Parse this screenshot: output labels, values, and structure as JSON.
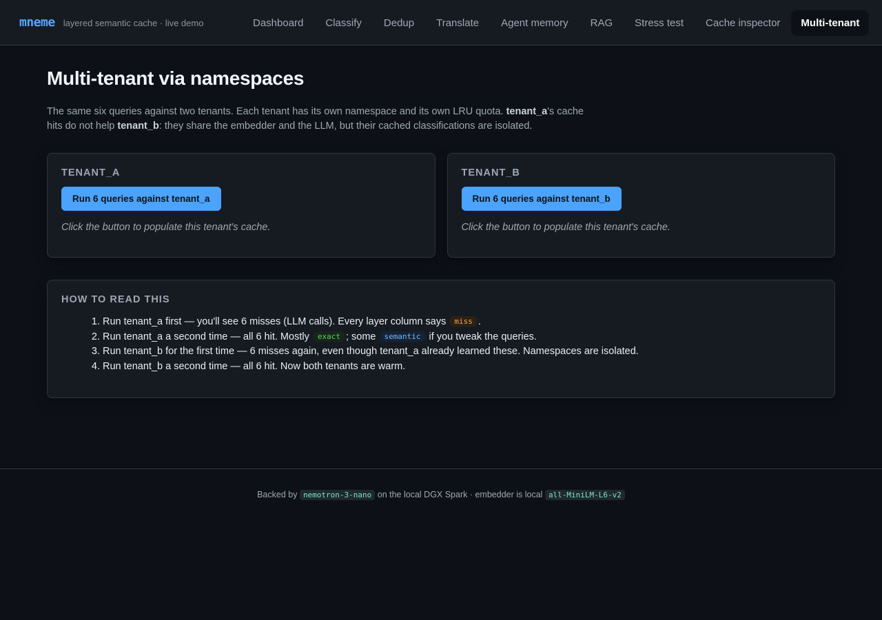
{
  "brand": {
    "name": "mneme",
    "tagline": "layered semantic cache · live demo"
  },
  "nav": {
    "items": [
      {
        "label": "Dashboard"
      },
      {
        "label": "Classify"
      },
      {
        "label": "Dedup"
      },
      {
        "label": "Translate"
      },
      {
        "label": "Agent memory"
      },
      {
        "label": "RAG"
      },
      {
        "label": "Stress test"
      },
      {
        "label": "Cache inspector"
      },
      {
        "label": "Multi-tenant"
      }
    ],
    "active": "Multi-tenant"
  },
  "page": {
    "title": "Multi-tenant via namespaces",
    "intro": {
      "part1": "The same six queries against two tenants. Each tenant has its own namespace and its own LRU quota. ",
      "bold1": "tenant_a",
      "part2": "'s cache hits do not help ",
      "bold2": "tenant_b",
      "part3": ": they share the embedder and the LLM, but their cached classifications are isolated."
    }
  },
  "tenants": [
    {
      "heading": "TENANT_A",
      "button_label": "Run 6 queries against tenant_a",
      "hint": "Click the button to populate this tenant's cache."
    },
    {
      "heading": "TENANT_B",
      "button_label": "Run 6 queries against tenant_b",
      "hint": "Click the button to populate this tenant's cache."
    }
  ],
  "howto": {
    "heading": "HOW TO READ THIS",
    "steps": [
      {
        "before": "Run tenant_a first — you'll see 6 misses (LLM calls). Every layer column says ",
        "pill": "miss",
        "after": "."
      },
      {
        "before": "Run tenant_a a second time — all 6 hit. Mostly ",
        "pill": "exact",
        "middle": "; some ",
        "pill2": "semantic",
        "after": " if you tweak the queries."
      },
      {
        "text": "Run tenant_b for the first time — 6 misses again, even though tenant_a already learned these. Namespaces are isolated."
      },
      {
        "text": "Run tenant_b a second time — all 6 hit. Now both tenants are warm."
      }
    ]
  },
  "footer": {
    "prefix": "Backed by ",
    "model": "nemotron-3-nano",
    "middle": " on the local DGX Spark · embedder is local ",
    "embedder": "all-MiniLM-L6-v2"
  },
  "colors": {
    "accent": "#58a6ff",
    "button": "#4ba3fb",
    "miss": "#f0a35e",
    "exact": "#56d364",
    "semantic": "#79b8ff"
  }
}
